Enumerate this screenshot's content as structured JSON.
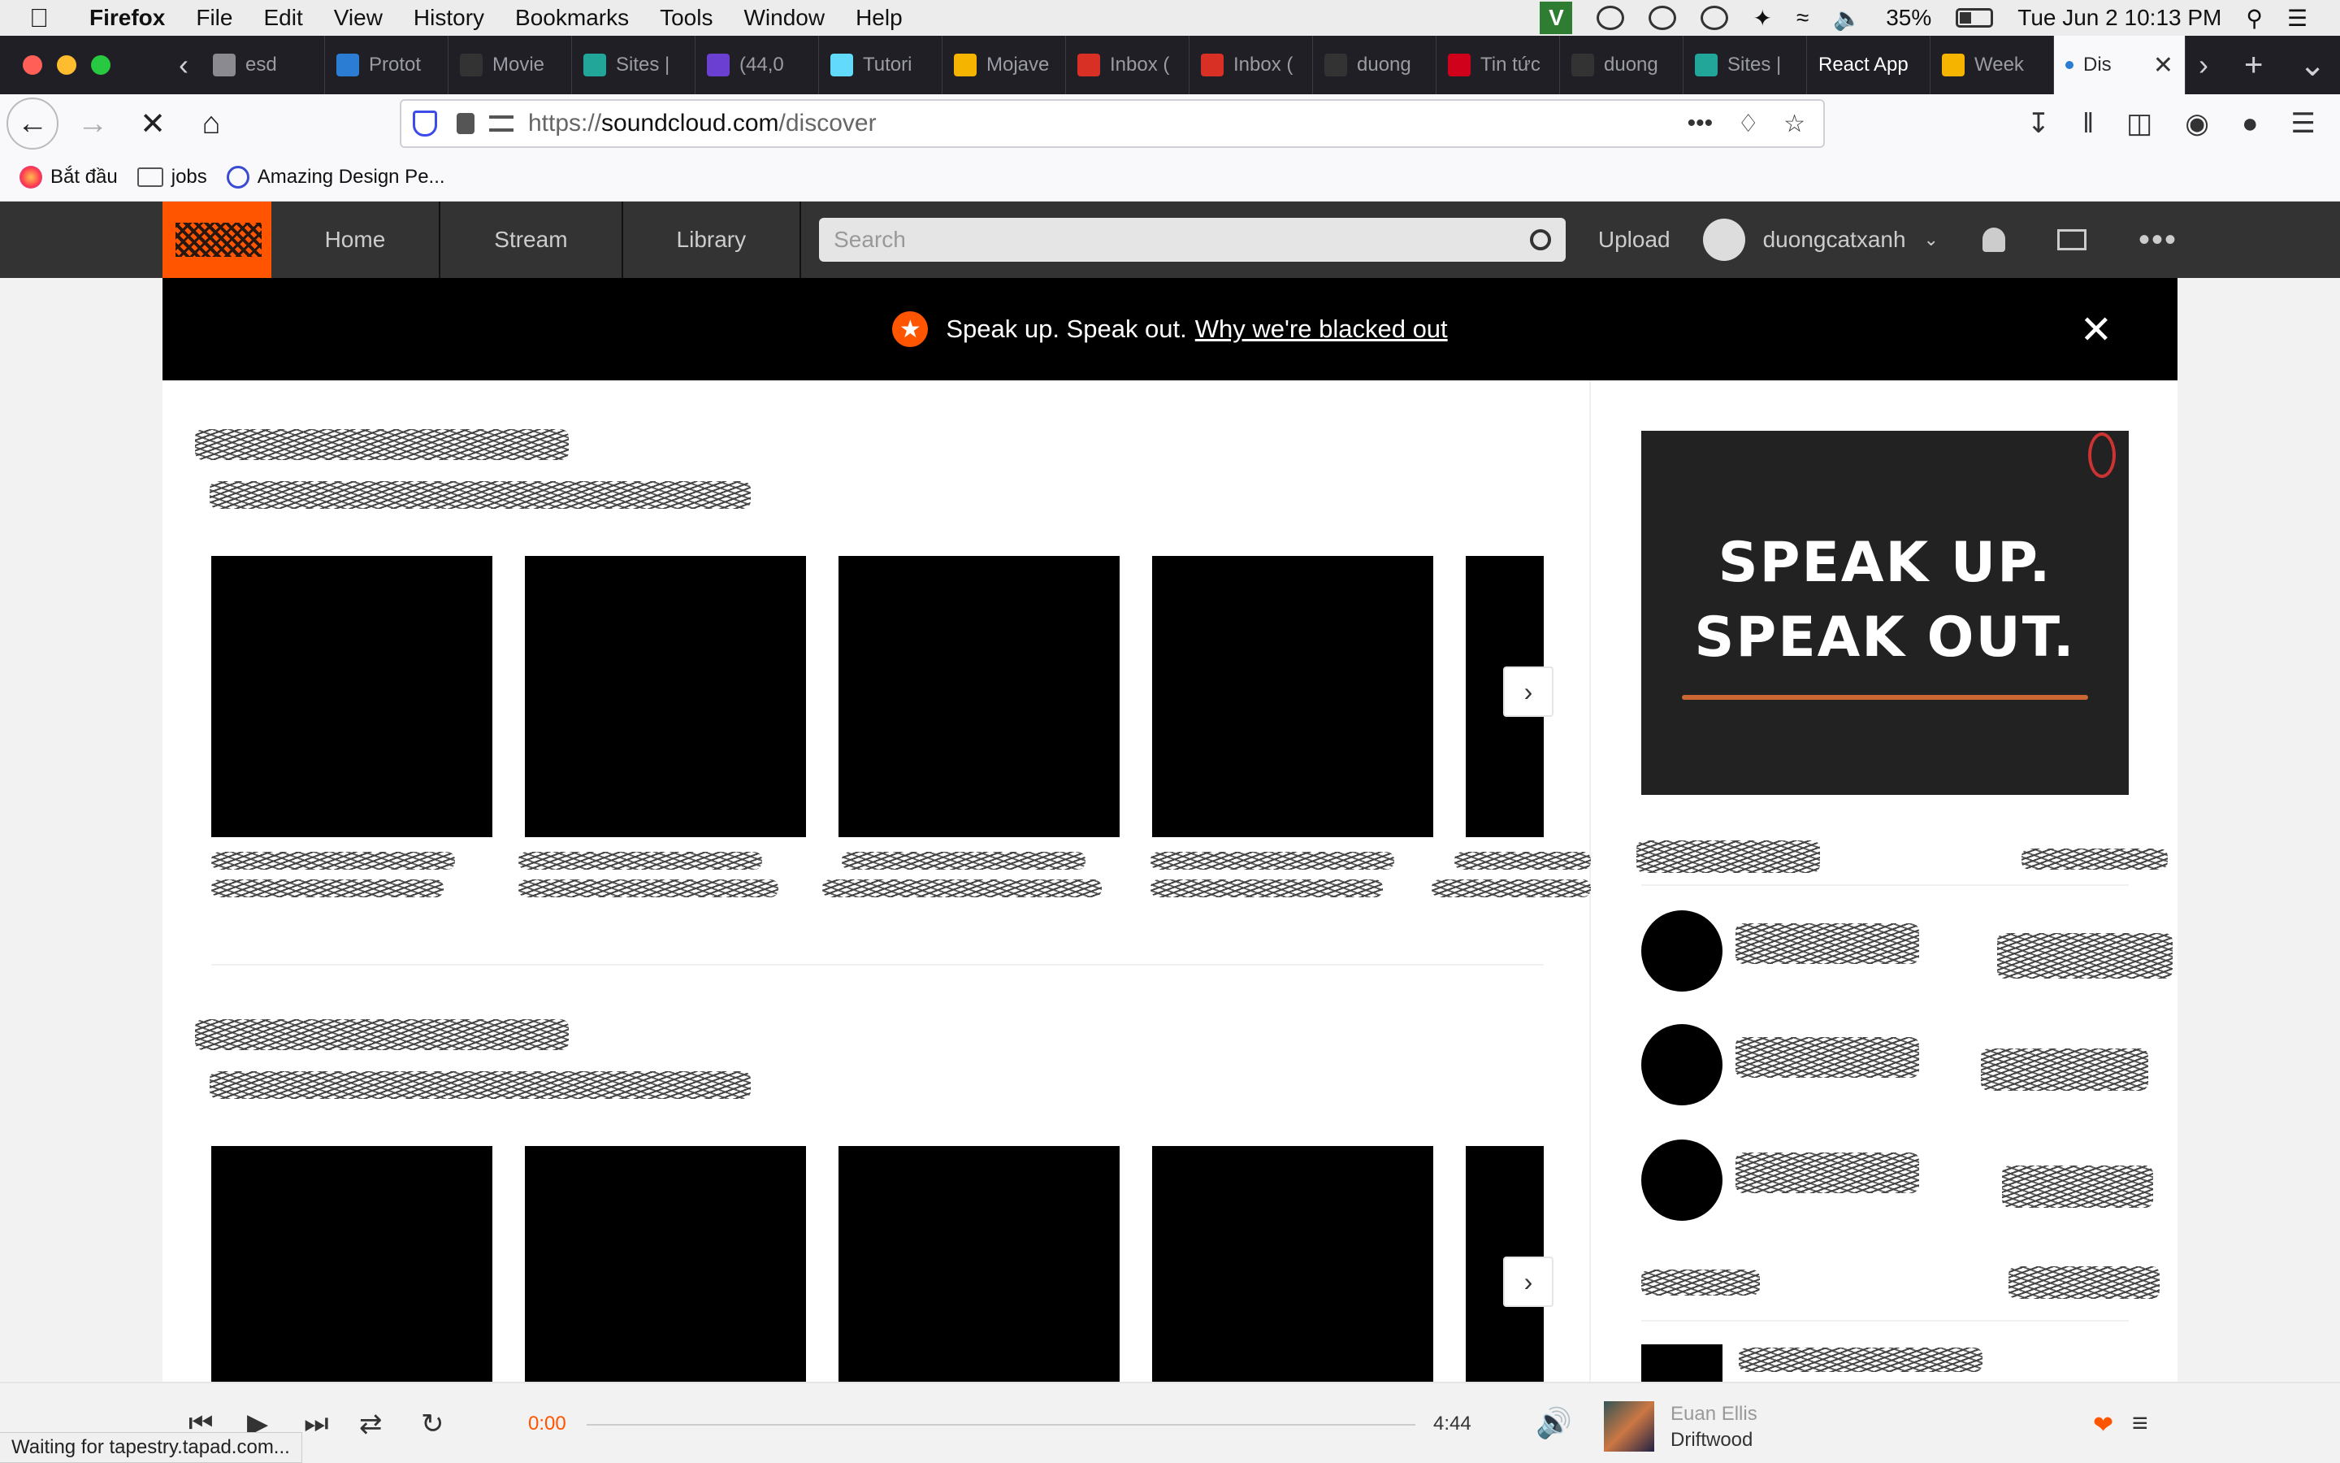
{
  "menubar": {
    "app": "Firefox",
    "items": [
      "File",
      "Edit",
      "View",
      "History",
      "Bookmarks",
      "Tools",
      "Window",
      "Help"
    ],
    "battery": "35%",
    "clock": "Tue Jun 2  10:13 PM",
    "v_badge": "V"
  },
  "tabs": [
    {
      "label": "esd",
      "icon": "generic-icon",
      "color": "#8a8a90"
    },
    {
      "label": "Protot",
      "icon": "word-icon",
      "color": "#2b7cd3"
    },
    {
      "label": "Movie",
      "icon": "doc-icon",
      "color": "#333333"
    },
    {
      "label": "Sites |",
      "icon": "sites-icon",
      "color": "#22a699"
    },
    {
      "label": "(44,0",
      "icon": "mail-icon",
      "color": "#6a3fd1"
    },
    {
      "label": "Tutori",
      "icon": "react-icon",
      "color": "#61dafb"
    },
    {
      "label": "Mojave",
      "icon": "drive-icon",
      "color": "#f4b400"
    },
    {
      "label": "Inbox (",
      "icon": "gmail-icon",
      "color": "#d93025"
    },
    {
      "label": "Inbox (",
      "icon": "gmail-icon",
      "color": "#d93025"
    },
    {
      "label": "duong",
      "icon": "github-icon",
      "color": "#333333"
    },
    {
      "label": "Tin tức",
      "icon": "news-icon",
      "color": "#d0021b"
    },
    {
      "label": "duong",
      "icon": "github-icon",
      "color": "#333333"
    },
    {
      "label": "Sites |",
      "icon": "sites-icon",
      "color": "#22a699"
    },
    {
      "label": "React App",
      "icon": "none",
      "color": "#ffffff"
    },
    {
      "label": "Week",
      "icon": "drive-icon",
      "color": "#f4b400"
    },
    {
      "label": "Dis",
      "icon": "loading-icon",
      "color": "#2b7cd3",
      "active": true
    }
  ],
  "navbar": {
    "url_prefix": "https://",
    "url_host": "soundcloud.com",
    "url_path": "/discover"
  },
  "bookmarks": [
    {
      "label": "Bắt đầu",
      "icon": "firefox-icon"
    },
    {
      "label": "jobs",
      "icon": "folder-icon"
    },
    {
      "label": "Amazing Design Pe...",
      "icon": "design-icon"
    }
  ],
  "soundcloud": {
    "nav": [
      "Home",
      "Stream",
      "Library"
    ],
    "search_placeholder": "Search",
    "upload": "Upload",
    "username": "duongcatxanh",
    "brand_color": "#ff5500"
  },
  "banner": {
    "text": "Speak up. Speak out.",
    "link": "Why we're blacked out"
  },
  "promo": {
    "line1": "SPEAK UP.",
    "line2": "SPEAK OUT."
  },
  "player": {
    "current_time": "0:00",
    "duration": "4:44",
    "progress": 0,
    "artist": "Euan Ellis",
    "track": "Driftwood"
  },
  "status": "Waiting for tapestry.tapad.com..."
}
